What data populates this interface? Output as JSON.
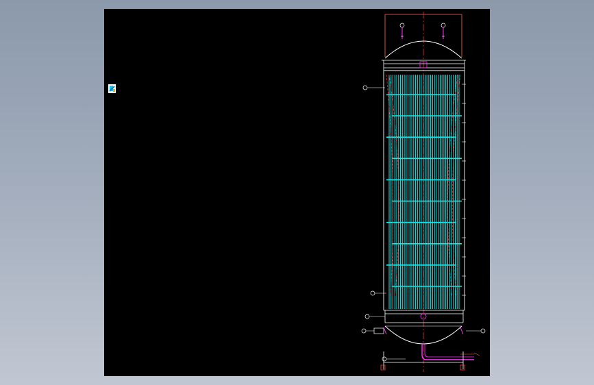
{
  "viewport": {
    "background": "#000000"
  },
  "ucs_icon": {
    "name": "ucs-icon"
  },
  "colors": {
    "outline": "#ffffff",
    "centerline": "#ff3b3b",
    "tubes": "#19e6e6",
    "nozzle": "#ff33ff",
    "frame": "#ff6a4d"
  },
  "tubes": {
    "count": 38
  },
  "baffles": {
    "count": 10
  }
}
